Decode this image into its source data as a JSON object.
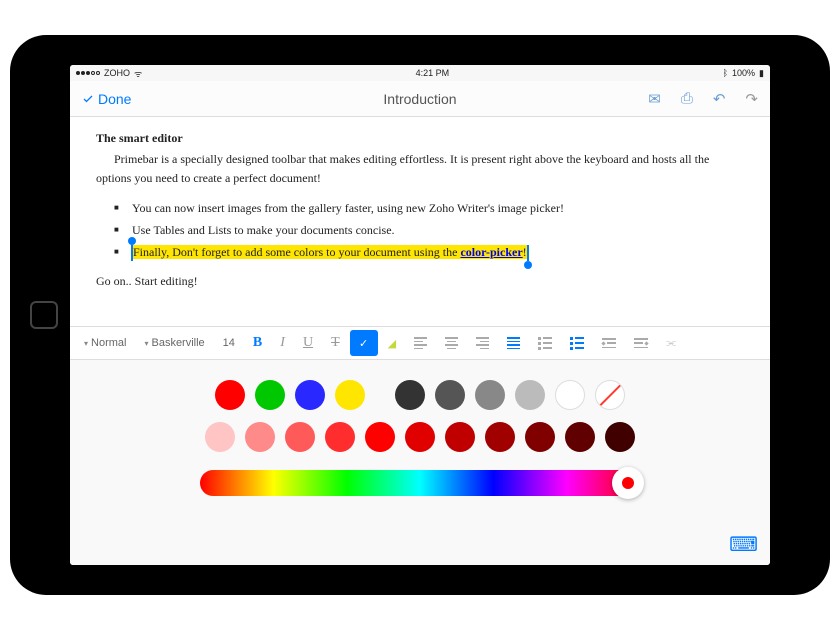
{
  "status": {
    "carrier": "ZOHO",
    "time": "4:21 PM",
    "battery": "100%"
  },
  "nav": {
    "done": "Done",
    "title": "Introduction"
  },
  "doc": {
    "heading": "The smart editor",
    "intro": "Primebar is a specially designed toolbar that makes editing effortless. It is present right above the keyboard and hosts all the options you need to create a perfect document!",
    "bullets": [
      "You can now insert images from the gallery faster, using new Zoho Writer's image picker!",
      "Use Tables and Lists to make your documents concise."
    ],
    "hl_pre": "Finally, Don't forget to add some colors to your document using the ",
    "hl_link": "color-picker",
    "hl_post": "!",
    "outro": "Go on.. Start editing!"
  },
  "toolbar": {
    "style": "Normal",
    "font": "Baskerville",
    "size": "14",
    "b": "B",
    "i": "I",
    "u": "U",
    "s": "T",
    "check": "✓"
  },
  "swatches_row1": [
    "#ff0000",
    "#00c800",
    "#2929ff",
    "#ffe600",
    "",
    "#333333",
    "#555555",
    "#888888",
    "#bbbbbb",
    "white",
    "none"
  ],
  "swatches_row2": [
    "#ffc4c4",
    "#ff8a8a",
    "#ff5a5a",
    "#ff2d2d",
    "#ff0000",
    "#e00000",
    "#c00000",
    "#a00000",
    "#800000",
    "#600000",
    "#400000"
  ]
}
